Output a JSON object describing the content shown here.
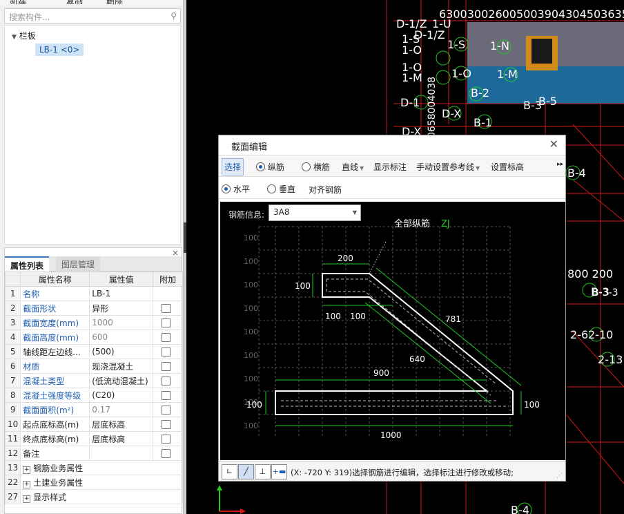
{
  "left_toolbar": {
    "new_label": "新建",
    "copy_label": "复制",
    "delete_label": "删除"
  },
  "search": {
    "placeholder": "搜索构件..."
  },
  "tree": {
    "parent": "栏板",
    "child": "LB-1 <0>"
  },
  "props": {
    "tabs": [
      "属性列表",
      "图层管理"
    ],
    "headers": {
      "name": "属性名称",
      "value": "属性值",
      "extra": "附加"
    },
    "rows": [
      {
        "n": "1",
        "name": "名称",
        "value": "LB-1",
        "blue": true,
        "grey": false,
        "check": false
      },
      {
        "n": "2",
        "name": "截面形状",
        "value": "异形",
        "blue": true,
        "grey": false,
        "check": true
      },
      {
        "n": "3",
        "name": "截面宽度(mm)",
        "value": "1000",
        "blue": true,
        "grey": true,
        "check": true
      },
      {
        "n": "4",
        "name": "截面高度(mm)",
        "value": "600",
        "blue": true,
        "grey": true,
        "check": true
      },
      {
        "n": "5",
        "name": "轴线距左边线...",
        "value": "(500)",
        "blue": false,
        "grey": false,
        "check": true
      },
      {
        "n": "6",
        "name": "材质",
        "value": "现浇混凝土",
        "blue": true,
        "grey": false,
        "check": true
      },
      {
        "n": "7",
        "name": "混凝土类型",
        "value": "(低流动混凝土)",
        "blue": true,
        "grey": false,
        "check": true
      },
      {
        "n": "8",
        "name": "混凝土强度等级",
        "value": "(C20)",
        "blue": true,
        "grey": false,
        "check": true
      },
      {
        "n": "9",
        "name": "截面面积(m²)",
        "value": "0.17",
        "blue": true,
        "grey": true,
        "check": true
      },
      {
        "n": "10",
        "name": "起点底标高(m)",
        "value": "层底标高",
        "blue": false,
        "grey": false,
        "check": true
      },
      {
        "n": "11",
        "name": "终点底标高(m)",
        "value": "层底标高",
        "blue": false,
        "grey": false,
        "check": true
      },
      {
        "n": "12",
        "name": "备注",
        "value": "",
        "blue": false,
        "grey": false,
        "check": true
      }
    ],
    "groups": [
      {
        "n": "13",
        "name": "钢筋业务属性"
      },
      {
        "n": "22",
        "name": "土建业务属性"
      },
      {
        "n": "27",
        "name": "显示样式"
      }
    ]
  },
  "dialog": {
    "title": "截面编辑",
    "toolbar": {
      "select": "选择",
      "longitudinal": "纵筋",
      "transverse": "横筋",
      "line": "直线",
      "show_dim": "显示标注",
      "manual_ref": "手动设置参考线",
      "set_elev": "设置标高"
    },
    "row2": {
      "horizontal": "水平",
      "vertical": "垂直",
      "align": "对齐钢筋"
    },
    "rebar_info_label": "钢筋信息:",
    "rebar_info_value": "3A8",
    "canvas": {
      "all_long_label": "全部纵筋",
      "zj_label": "ZJ",
      "grid_labels": [
        "100",
        "100",
        "100",
        "100",
        "100",
        "100",
        "100",
        "100",
        "100"
      ],
      "dims": {
        "d200": "200",
        "d100_left": "100",
        "d100_a": "100",
        "d100_b": "100",
        "d781": "781",
        "d640": "640",
        "d900": "900",
        "d100_bottom_left": "100",
        "d100_right": "100",
        "d1000": "1000"
      }
    },
    "status": "(X: -720 Y: 319)选择钢筋进行编辑，选择标注进行修改或移动;"
  },
  "cad_labels": {
    "top_numbers": "6300300260050039043045036350",
    "labels": [
      "D-1/Z",
      "1-U",
      "D-1/Z",
      "1-S",
      "1-S",
      "1-O",
      "1-N",
      "1-O",
      "1-O",
      "1-M",
      "1-M",
      "B-2",
      "D-1",
      "D-X",
      "B-1",
      "B-3",
      "B-5",
      "D-X",
      "B-4",
      "B-3",
      "2-6",
      "2-10",
      "2-13",
      "B-4"
    ],
    "vertical_numbers": "0658004038",
    "right_numbers": "800 200",
    "b3_text": "B-3-3"
  },
  "colors": {
    "accent": "#1f5fb3",
    "cad_red": "#d01818",
    "cad_green": "#22cc22",
    "cad_white": "#ffffff"
  }
}
